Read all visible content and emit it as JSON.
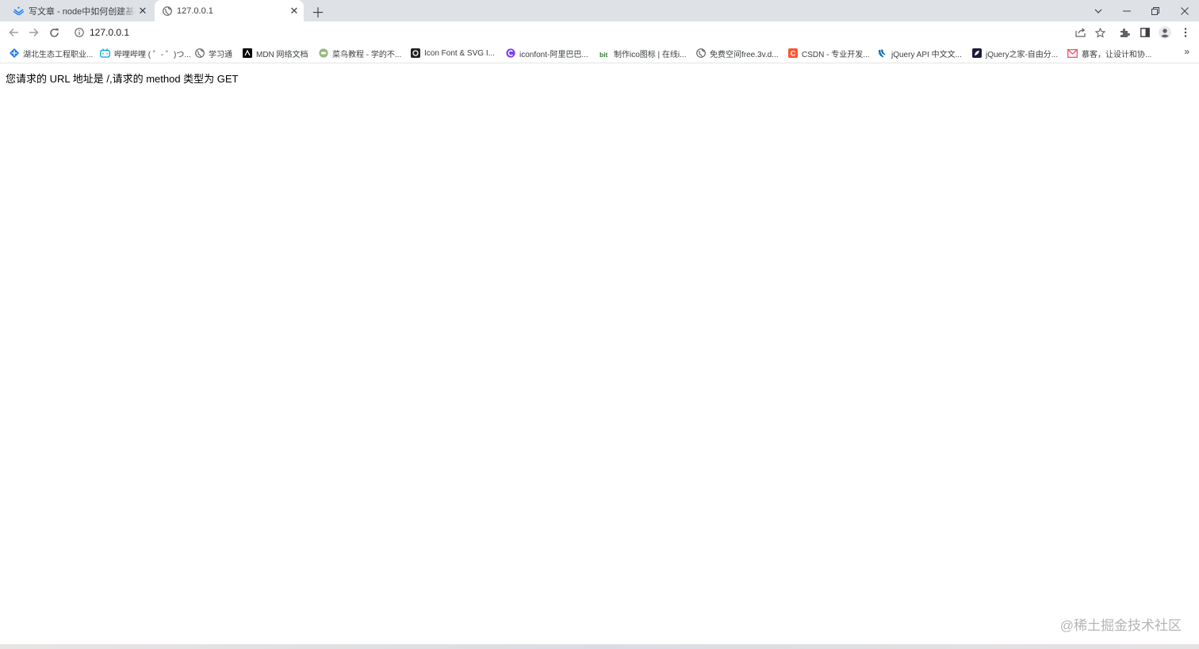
{
  "browser": {
    "tabs": [
      {
        "title": "写文章 - node中如何创建基本的",
        "icon": "juejin-icon",
        "active": false
      },
      {
        "title": "127.0.0.1",
        "icon": "globe-icon",
        "active": true
      }
    ],
    "address": "127.0.0.1",
    "bookmarks": [
      {
        "label": "湖北生态工程职业...",
        "icon": "school-icon",
        "color": "#1a73e8"
      },
      {
        "label": "哔哩哔哩 ( ゜- ゜)つ...",
        "icon": "bilibili-icon",
        "color": "#00a1d6"
      },
      {
        "label": "学习通",
        "icon": "globe-icon",
        "color": "#5f6368"
      },
      {
        "label": "MDN 网络文档",
        "icon": "mdn-icon",
        "color": "#000000"
      },
      {
        "label": "菜鸟教程 - 学的不...",
        "icon": "runoob-icon",
        "color": "#96b97d"
      },
      {
        "label": "Icon Font & SVG I...",
        "icon": "iconfont-svg-icon",
        "color": "#222222"
      },
      {
        "label": "iconfont-阿里巴巴...",
        "icon": "iconfont-icon",
        "color": "#7b3ff2"
      },
      {
        "label": "制作ico图标 | 在线i...",
        "icon": "bitbug-icon",
        "color": "#2e7d32"
      },
      {
        "label": "免费空间free.3v.d...",
        "icon": "globe-icon",
        "color": "#5f6368"
      },
      {
        "label": "CSDN - 专业开发...",
        "icon": "csdn-icon",
        "color": "#fc5531"
      },
      {
        "label": "jQuery API 中文文...",
        "icon": "jquery-icon",
        "color": "#0769ad"
      },
      {
        "label": "jQuery之家-自由分...",
        "icon": "htmleaf-icon",
        "color": "#1c1c3c"
      },
      {
        "label": "慕客，让设计和协...",
        "icon": "mockplus-icon",
        "color": "#e9546b"
      }
    ]
  },
  "page": {
    "message": "您请求的 URL 地址是 /,请求的 method 类型为 GET",
    "watermark": "@稀土掘金技术社区"
  }
}
